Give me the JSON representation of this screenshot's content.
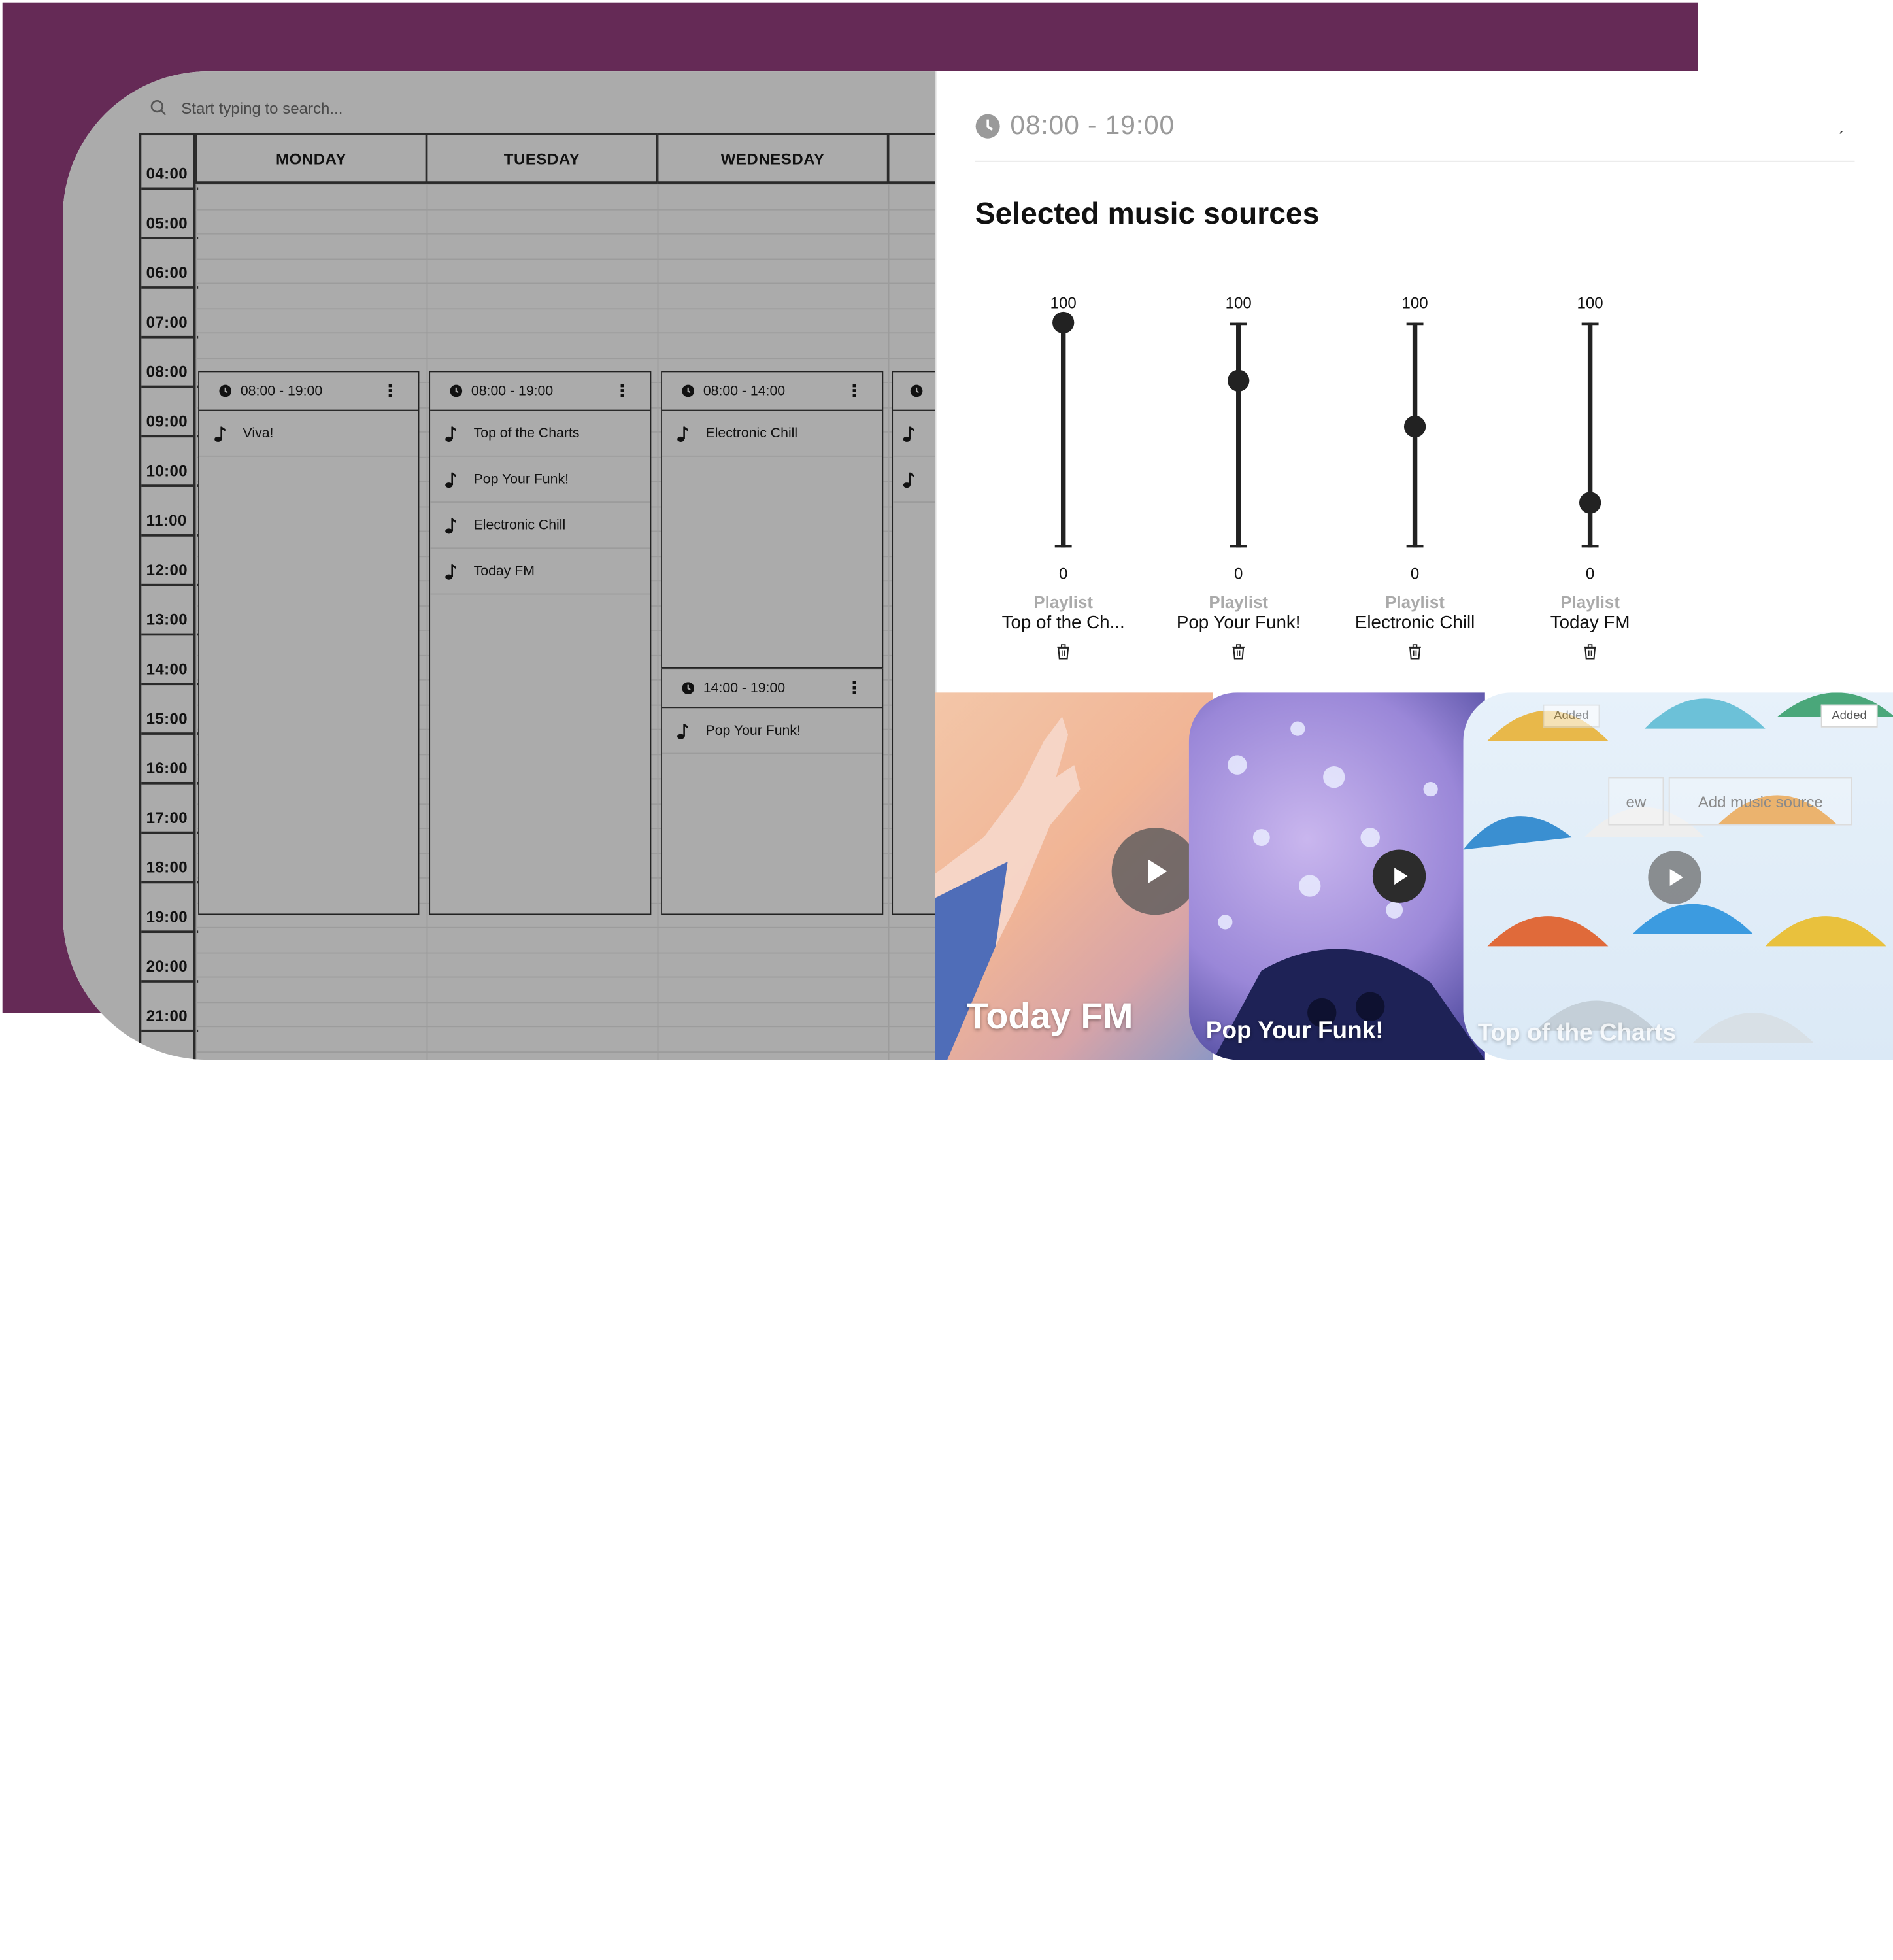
{
  "search": {
    "placeholder": "Start typing to search..."
  },
  "calendar": {
    "days": [
      "MONDAY",
      "TUESDAY",
      "WEDNESDAY"
    ],
    "hours": [
      "04:00",
      "05:00",
      "06:00",
      "07:00",
      "08:00",
      "09:00",
      "10:00",
      "11:00",
      "12:00",
      "13:00",
      "14:00",
      "15:00",
      "16:00",
      "17:00",
      "18:00",
      "19:00",
      "20:00",
      "21:00"
    ],
    "blocks": [
      {
        "time": "08:00 - 19:00",
        "items": [
          "Viva!"
        ]
      },
      {
        "time": "08:00 - 19:00",
        "items": [
          "Top of the Charts",
          "Pop Your Funk!",
          "Electronic Chill",
          "Today FM"
        ]
      },
      {
        "time": "08:00 - 14:00",
        "items": [
          "Electronic Chill"
        ]
      },
      {
        "time": "14:00 - 19:00",
        "items": [
          "Pop Your Funk!"
        ]
      }
    ]
  },
  "panel": {
    "time": "08:00 - 19:00",
    "title": "Selected music sources",
    "sources": [
      {
        "type": "Playlist",
        "name": "Top of the Ch...",
        "max": "100",
        "min": "0",
        "level": 100
      },
      {
        "type": "Playlist",
        "name": "Pop Your Funk!",
        "max": "100",
        "min": "0",
        "level": 74
      },
      {
        "type": "Playlist",
        "name": "Electronic Chill",
        "max": "100",
        "min": "0",
        "level": 54
      },
      {
        "type": "Playlist",
        "name": "Today FM",
        "max": "100",
        "min": "0",
        "level": 20
      }
    ]
  },
  "cards": {
    "today": "Today FM",
    "funk": "Pop Your Funk!",
    "charts": "Top of the Charts",
    "badge_added_1": "Added",
    "badge_added_2": "Added",
    "btn_view_partial": "ew",
    "btn_add": "Add music source"
  },
  "colors": {
    "brand": "#652a56",
    "grey": "#ababab"
  }
}
